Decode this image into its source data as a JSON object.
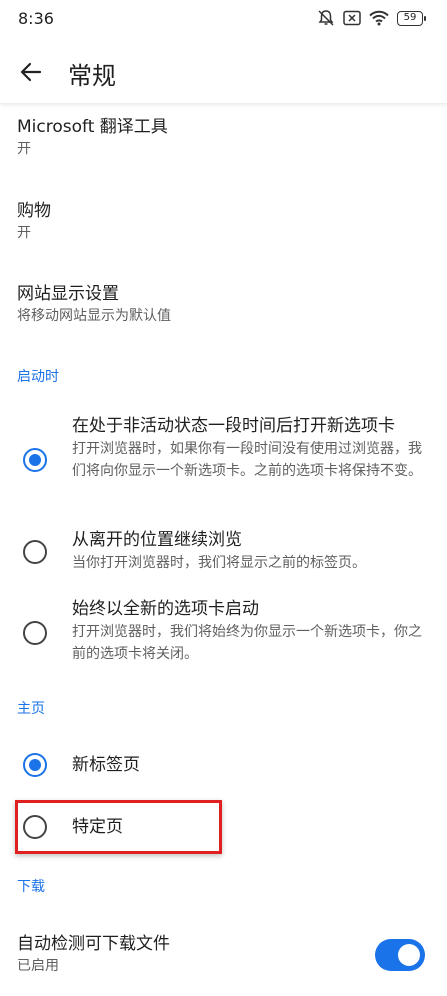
{
  "status_bar": {
    "time": "8:36",
    "battery": "59"
  },
  "app_bar": {
    "title": "常规"
  },
  "general_items": [
    {
      "title": "Microsoft 翻译工具",
      "summary": "开"
    },
    {
      "title": "购物",
      "summary": "开"
    },
    {
      "title": "网站显示设置",
      "summary": "将移动网站显示为默认值"
    }
  ],
  "startup": {
    "header": "启动时",
    "options": [
      {
        "title": "在处于非活动状态一段时间后打开新选项卡",
        "description": "打开浏览器时，如果你有一段时间没有使用过浏览器，我们将向你显示一个新选项卡。之前的选项卡将保持不变。",
        "selected": true
      },
      {
        "title": "从离开的位置继续浏览",
        "description": "当你打开浏览器时，我们将显示之前的标签页。",
        "selected": false
      },
      {
        "title": "始终以全新的选项卡启动",
        "description": "打开浏览器时，我们将始终为你显示一个新选项卡，你之前的选项卡将关闭。",
        "selected": false
      }
    ]
  },
  "homepage": {
    "header": "主页",
    "options": [
      {
        "title": "新标签页",
        "selected": true
      },
      {
        "title": "特定页",
        "selected": false
      }
    ]
  },
  "downloads": {
    "header": "下载",
    "auto_detect": {
      "title": "自动检测可下载文件",
      "summary": "已启用",
      "enabled": true
    }
  },
  "colors": {
    "accent": "#1a73e8",
    "highlight": "#e02020"
  }
}
